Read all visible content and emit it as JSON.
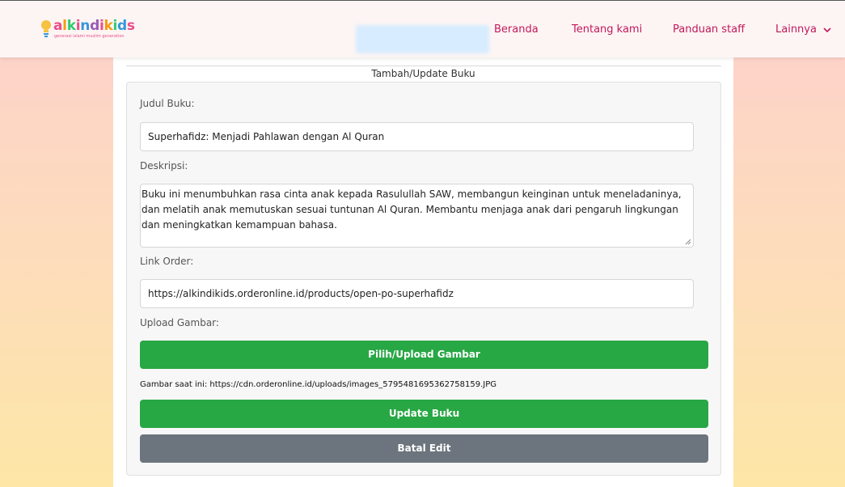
{
  "brand": {
    "letters": [
      "a",
      "l",
      "k",
      "i",
      "n",
      "d",
      "i",
      "k",
      "i",
      "d",
      "s"
    ],
    "letter_colors": [
      "#e94e8a",
      "#f39c12",
      "#2ecc71",
      "#e94e8a",
      "#3498db",
      "#9b59b6",
      "#e94e8a",
      "#f39c12",
      "#2ecc71",
      "#3498db",
      "#e94e8a"
    ],
    "tagline": "generasi islami muslim generation",
    "bulb_color": "#f5c242"
  },
  "nav": {
    "items": [
      {
        "label": "Beranda"
      },
      {
        "label": "Tentang kami"
      },
      {
        "label": "Panduan staff"
      },
      {
        "label": "Lainnya"
      }
    ],
    "color": "#c2185b"
  },
  "form": {
    "title": "Tambah/Update Buku",
    "judul_label": "Judul Buku:",
    "judul_value": "Superhafidz: Menjadi Pahlawan dengan Al Quran",
    "deskripsi_label": "Deskripsi:",
    "deskripsi_value": "Buku ini menumbuhkan rasa cinta anak kepada Rasulullah SAW, membangun keinginan untuk meneladaninya, dan melatih anak memutuskan sesuai tuntunan Al Quran. Membantu menjaga anak dari pengaruh lingkungan dan meningkatkan kemampuan bahasa.",
    "link_label": "Link Order:",
    "link_value": "https://alkindikids.orderonline.id/products/open-po-superhafidz",
    "upload_label": "Upload Gambar:",
    "upload_button": "Pilih/Upload Gambar",
    "current_image": "Gambar saat ini: https://cdn.orderonline.id/uploads/images_5795481695362758159.JPG",
    "update_button": "Update Buku",
    "cancel_button": "Batal Edit"
  },
  "colors": {
    "primary_green": "#28a745",
    "secondary_gray": "#6c757d"
  }
}
